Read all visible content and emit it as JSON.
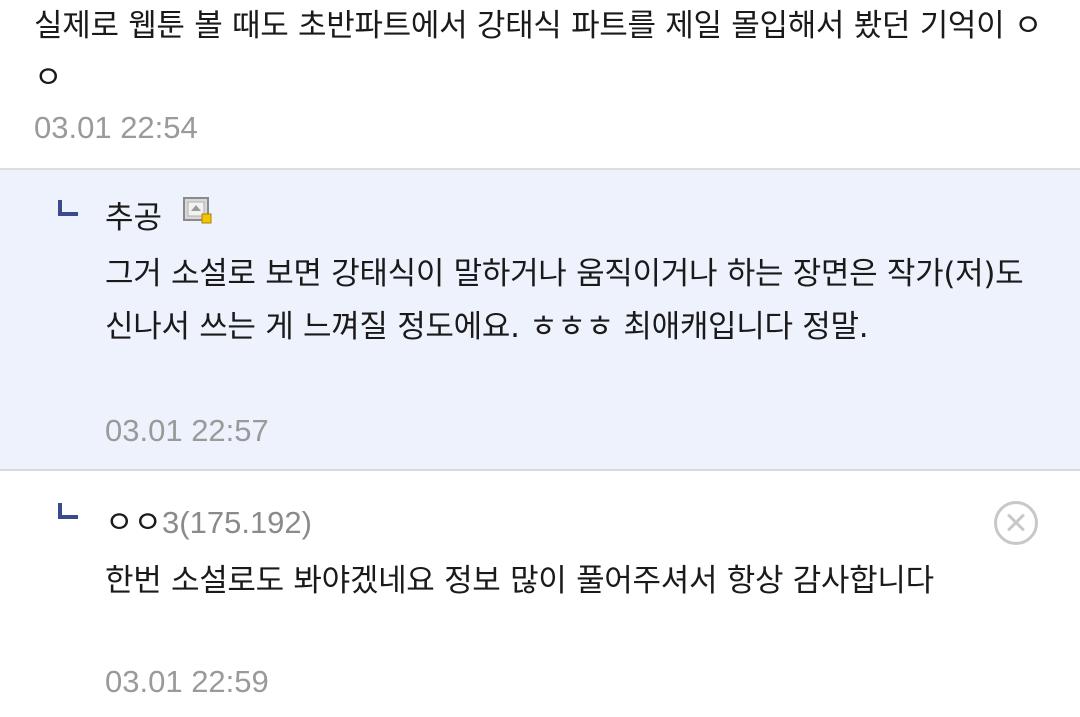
{
  "comments": [
    {
      "text": "실제로 웹툰 볼 때도 초반파트에서 강태식 파트를 제일 몰입해서 봤던 기억이 ㅇㅇ",
      "time": "03.01 22:54"
    },
    {
      "author": "추공",
      "badge_icon": "manager-badge-icon",
      "text": "그거 소설로 보면 강태식이 말하거나 움직이거나 하는 장면은 작가(저)도 신나서 쓰는 게 느껴질 정도에요. ㅎㅎㅎ 최애캐입니다 정말.",
      "time": "03.01 22:57"
    },
    {
      "author": "ㅇㅇ",
      "author_ip": "3(175.192)",
      "text": "한번 소설로도 봐야겠네요 정보 많이 풀어주셔서 항상 감사합니다",
      "time": "03.01 22:59",
      "delete_icon": "close-circle-icon"
    }
  ],
  "colors": {
    "reply_background": "#eef2fc",
    "reply_arrow": "#3a4a8c",
    "timestamp": "#9a9a9a",
    "ip_text": "#8a8a8a"
  }
}
